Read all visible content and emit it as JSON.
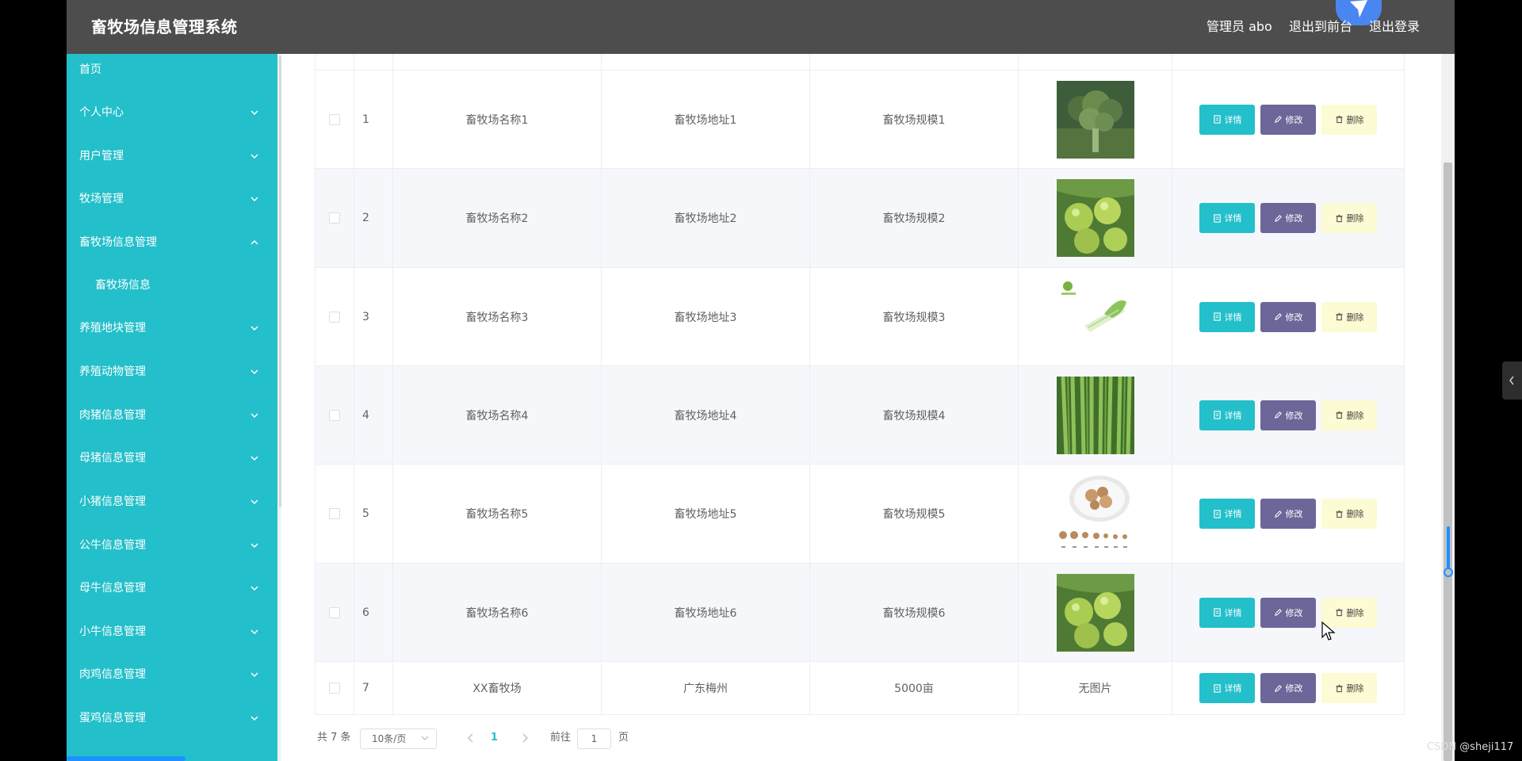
{
  "header": {
    "title": "畜牧场信息管理系统",
    "user": "管理员 abo",
    "front": "退出到前台",
    "logout": "退出登录"
  },
  "sidebar": {
    "items": [
      {
        "label": "首页",
        "chevron": "none"
      },
      {
        "label": "个人中心",
        "chevron": "down"
      },
      {
        "label": "用户管理",
        "chevron": "down"
      },
      {
        "label": "牧场管理",
        "chevron": "down"
      },
      {
        "label": "畜牧场信息管理",
        "chevron": "up"
      },
      {
        "label": "畜牧场信息",
        "chevron": "none"
      },
      {
        "label": "养殖地块管理",
        "chevron": "down"
      },
      {
        "label": "养殖动物管理",
        "chevron": "down"
      },
      {
        "label": "肉猪信息管理",
        "chevron": "down"
      },
      {
        "label": "母猪信息管理",
        "chevron": "down"
      },
      {
        "label": "小猪信息管理",
        "chevron": "down"
      },
      {
        "label": "公牛信息管理",
        "chevron": "down"
      },
      {
        "label": "母牛信息管理",
        "chevron": "down"
      },
      {
        "label": "小牛信息管理",
        "chevron": "down"
      },
      {
        "label": "肉鸡信息管理",
        "chevron": "down"
      },
      {
        "label": "蛋鸡信息管理",
        "chevron": "down"
      }
    ]
  },
  "table": {
    "rows": [
      {
        "index": "1",
        "name": "畜牧场名称1",
        "address": "畜牧场地址1",
        "scale": "畜牧场规模1",
        "image": "broccoli"
      },
      {
        "index": "2",
        "name": "畜牧场名称2",
        "address": "畜牧场地址2",
        "scale": "畜牧场规模2",
        "image": "jujube"
      },
      {
        "index": "3",
        "name": "畜牧场名称3",
        "address": "畜牧场地址3",
        "scale": "畜牧场规模3",
        "image": "cabbage"
      },
      {
        "index": "4",
        "name": "畜牧场名称4",
        "address": "畜牧场地址4",
        "scale": "畜牧场规模4",
        "image": "beans"
      },
      {
        "index": "5",
        "name": "畜牧场名称5",
        "address": "畜牧场地址5",
        "scale": "畜牧场规模5",
        "image": "ginger"
      },
      {
        "index": "6",
        "name": "畜牧场名称6",
        "address": "畜牧场地址6",
        "scale": "畜牧场规模6",
        "image": "jujube"
      },
      {
        "index": "7",
        "name": "XX畜牧场",
        "address": "广东梅州",
        "scale": "5000亩",
        "image": "none"
      }
    ],
    "no_image_text": "无图片",
    "buttons": {
      "detail": "详情",
      "edit": "修改",
      "delete": "删除"
    }
  },
  "pagination": {
    "total": "共 7 条",
    "page_size": "10条/页",
    "current": "1",
    "goto_label": "前往",
    "goto_value": "1",
    "goto_unit": "页"
  },
  "watermark": "CSDN @sheji117",
  "icons": {
    "detail": "document-icon",
    "edit": "pencil-icon",
    "delete": "trash-icon"
  },
  "colors": {
    "header_bg": "#4d4d4d",
    "sidebar_bg": "#23bfca",
    "detail_btn": "#23bfca",
    "edit_btn": "#6d6699",
    "delete_btn": "#fdfbd3"
  }
}
